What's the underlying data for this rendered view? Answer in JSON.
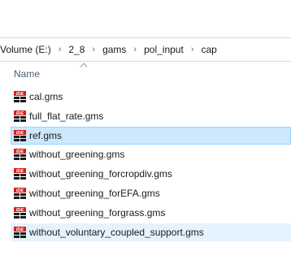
{
  "breadcrumb": {
    "items": [
      "Volume (E:)",
      "2_8",
      "gams",
      "pol_input",
      "cap"
    ],
    "separator": "›"
  },
  "columns": {
    "name_label": "Name"
  },
  "files": [
    {
      "name": "cal.gms",
      "icon": "gams-ide-icon",
      "state": "normal"
    },
    {
      "name": "full_flat_rate.gms",
      "icon": "gams-ide-icon",
      "state": "normal"
    },
    {
      "name": "ref.gms",
      "icon": "gams-ide-icon",
      "state": "selected"
    },
    {
      "name": "without_greening.gms",
      "icon": "gams-ide-icon",
      "state": "normal"
    },
    {
      "name": "without_greening_forcropdiv.gms",
      "icon": "gams-ide-icon",
      "state": "normal"
    },
    {
      "name": "without_greening_forEFA.gms",
      "icon": "gams-ide-icon",
      "state": "normal"
    },
    {
      "name": "without_greening_forgrass.gms",
      "icon": "gams-ide-icon",
      "state": "normal"
    },
    {
      "name": "without_voluntary_coupled_support.gms",
      "icon": "gams-ide-icon",
      "state": "hover"
    }
  ],
  "colors": {
    "selected_bg": "#cce8ff",
    "selected_border": "#99d1ff",
    "hover_bg": "#e5f3ff",
    "header_text": "#4c607a",
    "icon_red": "#d42020"
  }
}
